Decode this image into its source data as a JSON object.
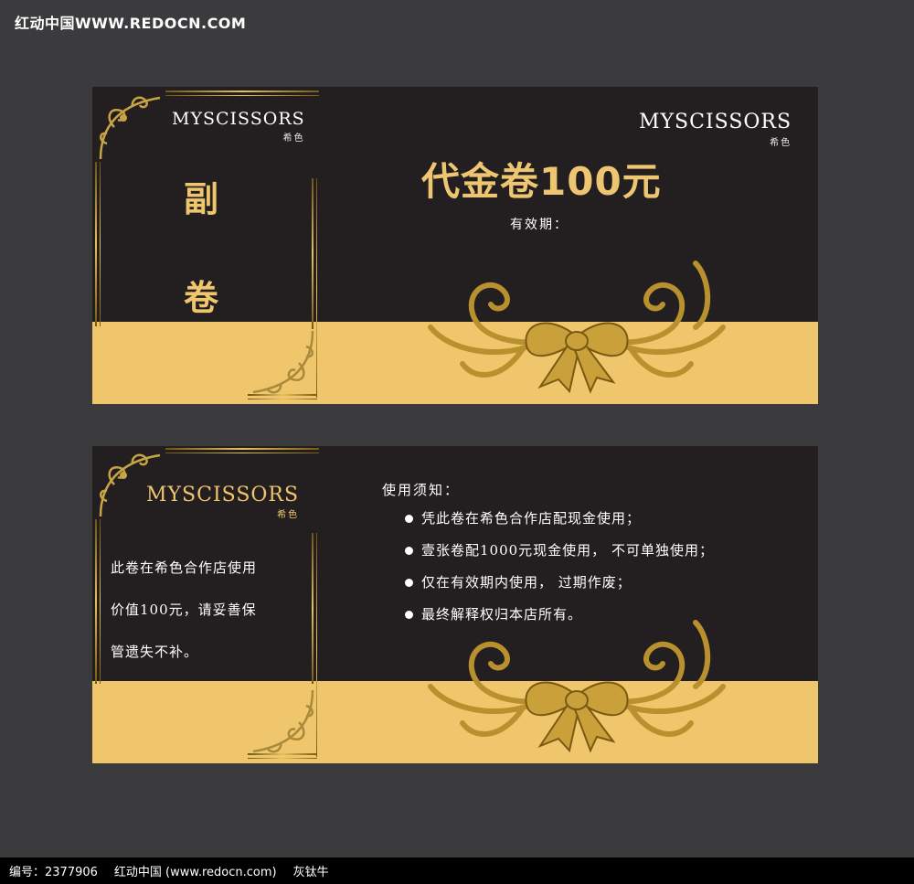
{
  "watermark": {
    "top_text": "红动中国WWW.REDOCN.COM"
  },
  "footer": {
    "id_text": "编号：2377906",
    "site_text": "红动中国 (www.redocn.com)",
    "author": "灰钛牛"
  },
  "front": {
    "stub": {
      "brand": "MYSCISSORS",
      "brand_sub": "希色",
      "title_top": "副",
      "title_bottom": "卷"
    },
    "main": {
      "brand": "MYSCISSORS",
      "brand_sub": "希色",
      "headline": "代金卷100元",
      "validity_label": "有效期："
    }
  },
  "back": {
    "stub": {
      "brand": "MYSCISSORS",
      "brand_sub": "希色",
      "lines": [
        "此卷在希色合作店使用",
        "价值100元，请妥善保",
        "管遗失不补。"
      ]
    },
    "main": {
      "notice_title": "使用须知：",
      "notices": [
        "凭此卷在希色合作店配现金使用；",
        "壹张卷配1000元现金使用， 不可单独使用；",
        "仅在有效期内使用， 过期作废；",
        "最终解释权归本店所有。"
      ]
    }
  },
  "colors": {
    "background": "#3b3b3d",
    "ticket": "#231f20",
    "gold": "#f0c66c",
    "headline": "#eec671"
  }
}
